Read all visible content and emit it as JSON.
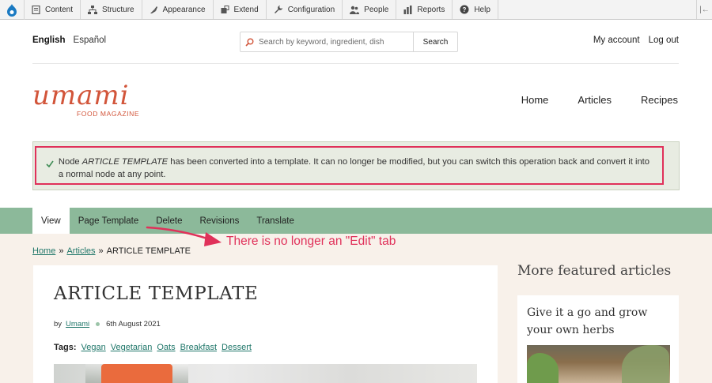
{
  "toolbar": {
    "items": [
      {
        "label": "Content",
        "icon": "content-icon"
      },
      {
        "label": "Structure",
        "icon": "structure-icon"
      },
      {
        "label": "Appearance",
        "icon": "appearance-icon"
      },
      {
        "label": "Extend",
        "icon": "extend-icon"
      },
      {
        "label": "Configuration",
        "icon": "wrench-icon"
      },
      {
        "label": "People",
        "icon": "people-icon"
      },
      {
        "label": "Reports",
        "icon": "reports-icon"
      },
      {
        "label": "Help",
        "icon": "help-icon"
      }
    ]
  },
  "header": {
    "languages": {
      "active": "English",
      "other": "Español"
    },
    "search": {
      "placeholder": "Search by keyword, ingredient, dish",
      "button": "Search"
    },
    "account": {
      "my_account": "My account",
      "logout": "Log out"
    },
    "logo": {
      "word": "umami",
      "tagline": "FOOD MAGAZINE"
    },
    "nav": [
      "Home",
      "Articles",
      "Recipes"
    ]
  },
  "message": {
    "prefix": "Node ",
    "node": "ARTICLE TEMPLATE",
    "rest": " has been converted into a template. It can no longer be modified, but you can switch this operation back and convert it into a normal node at any point."
  },
  "tabs": [
    "View",
    "Page Template",
    "Delete",
    "Revisions",
    "Translate"
  ],
  "annotation": "There is no longer an \"Edit\" tab",
  "breadcrumb": {
    "home": "Home",
    "articles": "Articles",
    "current": "ARTICLE TEMPLATE",
    "sep": "»"
  },
  "article": {
    "title": "ARTICLE TEMPLATE",
    "by": "by",
    "author": "Umami",
    "date": "6th August 2021",
    "tags_label": "Tags:",
    "tags": [
      "Vegan",
      "Vegetarian",
      "Oats",
      "Breakfast",
      "Dessert"
    ]
  },
  "sidebar": {
    "title": "More featured articles",
    "card_title": "Give it a go and grow your own herbs"
  },
  "colors": {
    "accent": "#d2553a",
    "tabs_band": "#8cb99a",
    "link": "#20776a",
    "annotation": "#e0315a"
  }
}
